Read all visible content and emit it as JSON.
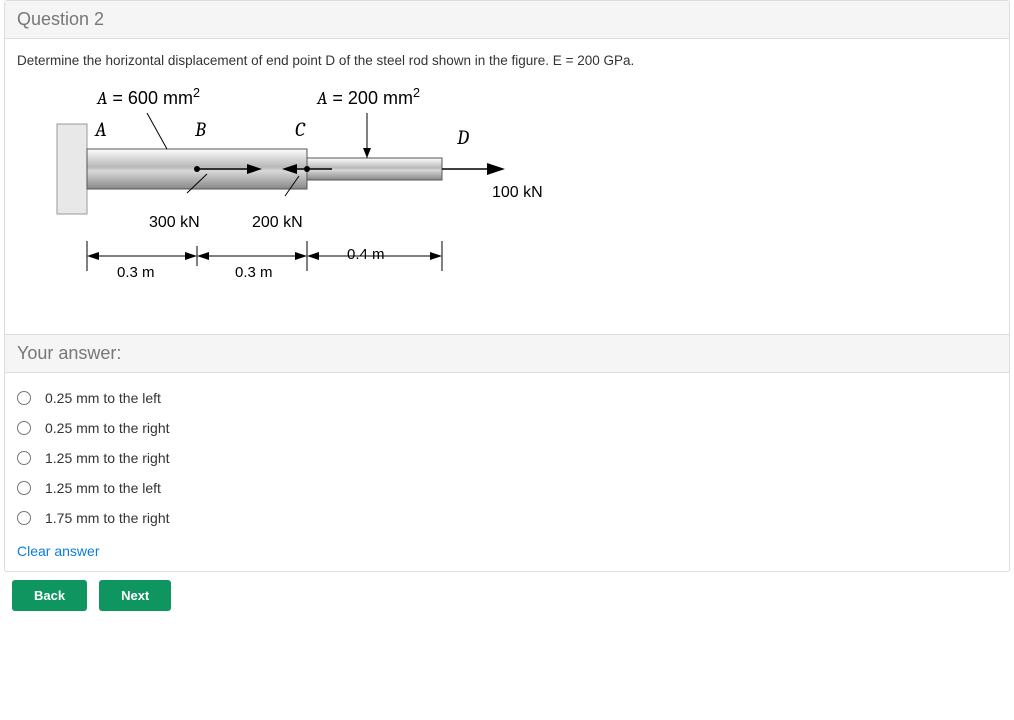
{
  "question": {
    "title": "Question 2",
    "prompt": "Determine the horizontal displacement of end point D of the steel rod shown in the figure. E = 200 GPa."
  },
  "figure": {
    "area1_prefix": "A",
    "area1_eq": " = 600 mm",
    "area2_prefix": "A",
    "area2_eq": " =  200 mm",
    "sq": "2",
    "ptA": "A",
    "ptB": "B",
    "ptC": "C",
    "ptD": "D",
    "force300": "300 kN",
    "force200": "200 kN",
    "force100": "100 kN",
    "dim03a": "0.3 m",
    "dim03b": "0.3 m",
    "dim04": "0.4 m"
  },
  "answer_header": "Your answer:",
  "options": [
    "0.25 mm to the left",
    "0.25 mm to the right",
    "1.25 mm  to the right",
    "1.25 mm  to the left",
    "1.75 mm to the right"
  ],
  "clear": "Clear answer",
  "back": "Back",
  "next": "Next"
}
